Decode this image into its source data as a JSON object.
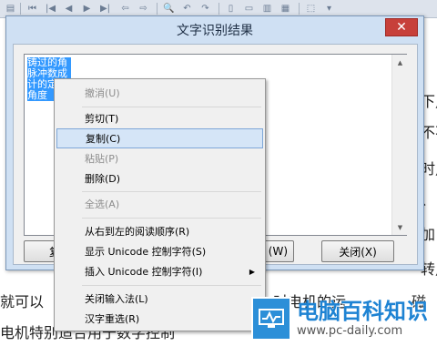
{
  "document": {
    "line_bottom_1": "就可以",
    "line_bottom_1_tail": "时电机的运",
    "line_bottom_2": "电机特别适合用于数字控制",
    "right_fragments": [
      "下,",
      "不不",
      "时,",
      "、",
      "加",
      "转,",
      "磁"
    ]
  },
  "dialog": {
    "title": "文字识别结果",
    "close_glyph": "✕",
    "recognized_text": "铸过的角脉冲数成计的定的角度",
    "buttons": {
      "copy": "复制",
      "save_suffix": "(W)",
      "close": "关闭(X)"
    }
  },
  "context_menu": {
    "items": [
      {
        "label": "撤消(U)"
      },
      {
        "label": "剪切(T)"
      },
      {
        "label": "复制(C)"
      },
      {
        "label": "粘贴(P)"
      },
      {
        "label": "删除(D)"
      },
      {
        "label": "全选(A)"
      },
      {
        "label": "从右到左的阅读顺序(R)"
      },
      {
        "label": "显示 Unicode 控制字符(S)"
      },
      {
        "label": "插入 Unicode 控制字符(I)"
      },
      {
        "label": "关闭输入法(L)"
      },
      {
        "label": "汉字重选(R)"
      }
    ]
  },
  "watermark": {
    "name": "电脑百科知识",
    "url": "www.pc-daily.com"
  }
}
